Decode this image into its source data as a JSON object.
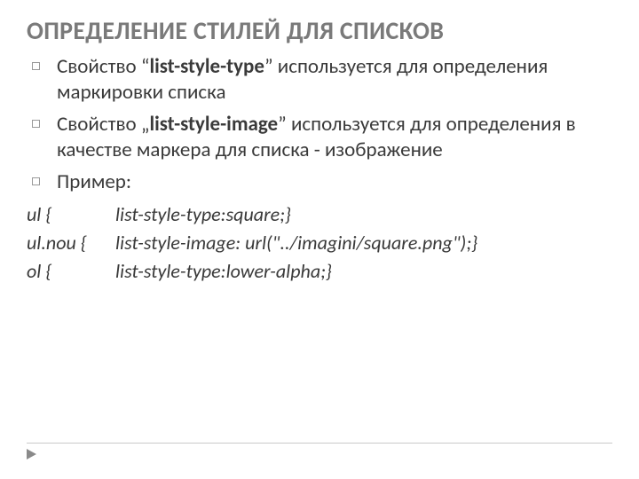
{
  "title": "ОПРЕДЕЛЕНИЕ СТИЛЕЙ ДЛЯ СПИСКОВ",
  "bullets": {
    "b1_prefix": "Свойство “",
    "b1_bold": "list-style-type",
    "b1_suffix": "” используется для определения маркировки списка",
    "b2_prefix": "Свойство „",
    "b2_bold": "list-style-image",
    "b2_suffix": "” используется для определения в качестве маркера для списка - изображение",
    "b3": "Пример:"
  },
  "code": {
    "r1_sel": "ul {",
    "r1_val": "list-style-type:square;}",
    "r2_sel": "ul.nou {",
    "r2_val": "list-style-image: url(\"../imagini/square.png\");}",
    "r3_sel": "ol {",
    "r3_val": "list-style-type:lower-alpha;}"
  }
}
